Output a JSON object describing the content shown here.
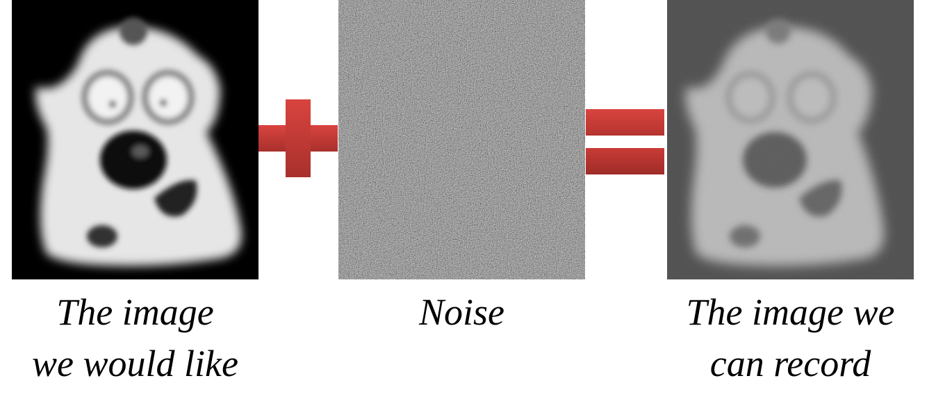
{
  "panels": {
    "clean": {
      "caption_line1": "The image",
      "caption_line2": "we would like"
    },
    "noise": {
      "caption": "Noise"
    },
    "noisy": {
      "caption_line1": "The image we",
      "caption_line2": "can record"
    }
  },
  "operators": {
    "plus": "plus-sign",
    "equals": "equals-sign"
  },
  "colors": {
    "operator_red": "#c43a35",
    "panel_black": "#000000",
    "noise_gray": "#808080"
  }
}
